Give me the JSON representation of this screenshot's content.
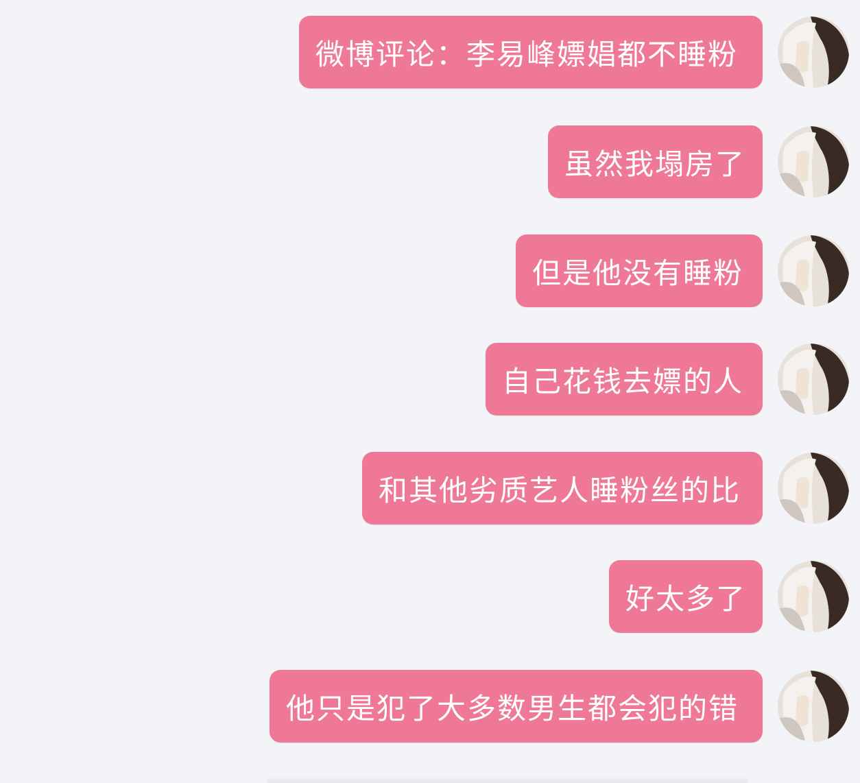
{
  "messages": [
    {
      "text": "微博评论：李易峰嫖娼都不睡粉"
    },
    {
      "text": "虽然我塌房了"
    },
    {
      "text": "但是他没有睡粉"
    },
    {
      "text": "自己花钱去嫖的人"
    },
    {
      "text": "和其他劣质艺人睡粉丝的比"
    },
    {
      "text": "好太多了"
    },
    {
      "text": "他只是犯了大多数男生都会犯的错"
    }
  ],
  "colors": {
    "background": "#f3f4f8",
    "bubble": "#ef7896",
    "bubble_text": "#ffffff"
  },
  "icons": {
    "avatar": "user-avatar-photo"
  }
}
